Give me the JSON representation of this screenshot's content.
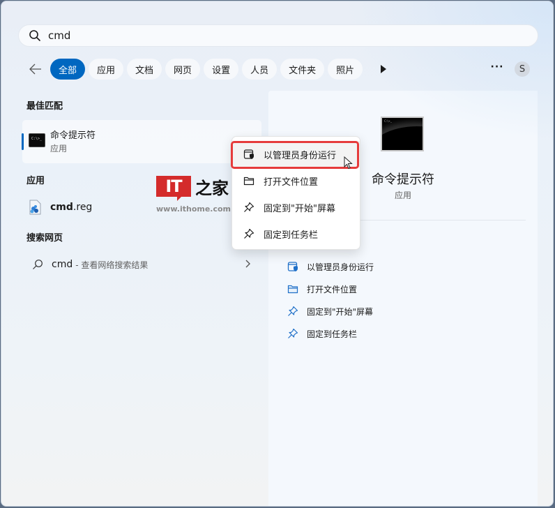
{
  "search": {
    "value": "cmd",
    "icon": "search-icon"
  },
  "filters": {
    "back_icon": "arrow-left-icon",
    "chips": [
      {
        "label": "全部",
        "active": true
      },
      {
        "label": "应用"
      },
      {
        "label": "文档"
      },
      {
        "label": "网页"
      },
      {
        "label": "设置"
      },
      {
        "label": "人员"
      },
      {
        "label": "文件夹"
      },
      {
        "label": "照片"
      }
    ],
    "play_icon": "play-icon",
    "more_label": "···",
    "avatar_initial": "S"
  },
  "left": {
    "best_match_title": "最佳匹配",
    "best_match": {
      "name": "命令提示符",
      "type": "应用",
      "icon_text": "C:\\>_"
    },
    "apps_title": "应用",
    "apps": [
      {
        "name_bold": "cmd",
        "name_rest": ".reg"
      }
    ],
    "web_title": "搜索网页",
    "web": {
      "query": "cmd",
      "hint": "- 查看网络搜索结果"
    }
  },
  "watermark": {
    "logo": "IT",
    "cn": "之家",
    "url": "www.ithome.com"
  },
  "context_menu": {
    "items": [
      {
        "label": "以管理员身份运行",
        "icon": "admin-shield-icon",
        "highlighted": true
      },
      {
        "label": "打开文件位置",
        "icon": "folder-icon"
      },
      {
        "label": "固定到\"开始\"屏幕",
        "icon": "pin-icon"
      },
      {
        "label": "固定到任务栏",
        "icon": "pin-icon"
      }
    ]
  },
  "right": {
    "app_name": "命令提示符",
    "app_type": "应用",
    "actions": [
      {
        "label": "以管理员身份运行",
        "icon": "admin-shield-icon"
      },
      {
        "label": "打开文件位置",
        "icon": "folder-icon"
      },
      {
        "label": "固定到\"开始\"屏幕",
        "icon": "pin-icon"
      },
      {
        "label": "固定到任务栏",
        "icon": "pin-icon"
      }
    ]
  },
  "colors": {
    "accent": "#0067c0",
    "highlight_border": "#e63b3b"
  }
}
